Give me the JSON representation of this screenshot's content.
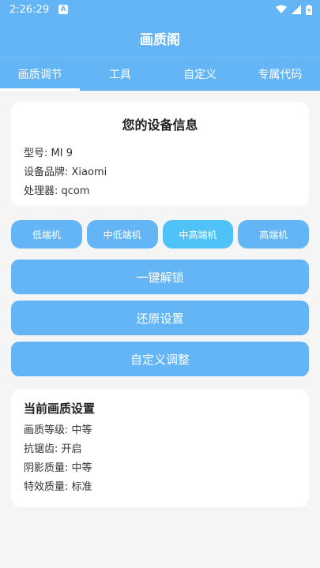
{
  "status_bar": {
    "time": "2:26:29",
    "notification_icon_letter": "A",
    "icons": [
      "wifi-icon",
      "signal-icon",
      "battery-icon"
    ]
  },
  "app_bar": {
    "title": "画质阁"
  },
  "tabs": [
    {
      "label": "画质调节",
      "active": true
    },
    {
      "label": "工具",
      "active": false
    },
    {
      "label": "自定义",
      "active": false
    },
    {
      "label": "专属代码",
      "active": false
    }
  ],
  "device_card": {
    "title": "您的设备信息",
    "model": "型号: MI 9",
    "brand": "设备品牌: Xiaomi",
    "processor": "处理器: qcom"
  },
  "tiers": [
    {
      "label": "低端机",
      "selected": false
    },
    {
      "label": "中低端机",
      "selected": false
    },
    {
      "label": "中高端机",
      "selected": true
    },
    {
      "label": "高端机",
      "selected": false
    }
  ],
  "actions": {
    "unlock": "一键解锁",
    "restore": "还原设置",
    "custom": "自定义调整"
  },
  "settings_card": {
    "title": "当前画质设置",
    "quality": "画质等级: 中等",
    "antialias": "抗锯齿: 开启",
    "shadow": "阴影质量: 中等",
    "effects": "特效质量: 标准"
  },
  "colors": {
    "primary": "#64b5f6",
    "selected_tier": "#4fc3f7",
    "background": "#f5f5f5"
  }
}
